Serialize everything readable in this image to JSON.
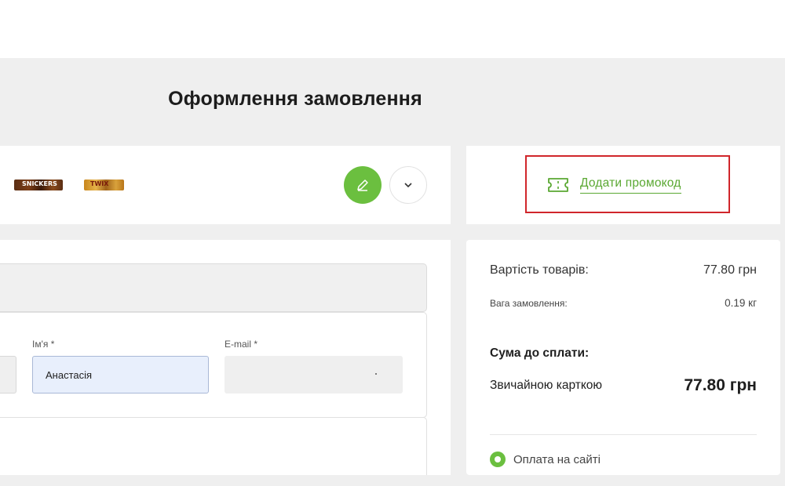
{
  "page": {
    "title": "Оформлення замовлення"
  },
  "products": {
    "items": [
      {
        "name": "SNICKERS",
        "icon": "snickers-bar-thumbnail"
      },
      {
        "name": "TWIX",
        "icon": "twix-bar-thumbnail"
      }
    ],
    "edit_icon": "pencil-icon",
    "expand_icon": "chevron-down-icon"
  },
  "promo": {
    "label": "Додати промокод",
    "icon": "ticket-icon",
    "accent_color": "#5aa832",
    "highlight_color": "#d0262b"
  },
  "form": {
    "first_name_label": "Ім'я *",
    "first_name_value": "Анастасія",
    "email_label": "E-mail *",
    "email_value": ""
  },
  "summary": {
    "goods_label": "Вартість товарів:",
    "goods_value": "77.80 грн",
    "weight_label": "Вага замовлення:",
    "weight_value": "0.19 кг",
    "total_heading": "Сума до сплати:",
    "card_label": "Звичайною карткою",
    "card_value": "77.80 грн",
    "payment_option_label": "Оплата на сайті",
    "payment_option_selected": true
  },
  "colors": {
    "brand_green": "#6bbf3f",
    "page_background": "#efefef"
  }
}
